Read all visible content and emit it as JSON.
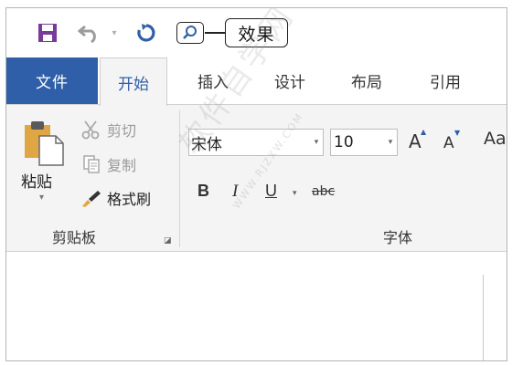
{
  "callout": {
    "text": "效果"
  },
  "tabs": {
    "file": "文件",
    "home": "开始",
    "insert": "插入",
    "design": "设计",
    "layout": "布局",
    "references": "引用"
  },
  "clipboard": {
    "paste": "粘贴",
    "cut": "剪切",
    "copy": "复制",
    "format_painter": "格式刷",
    "group_label": "剪贴板"
  },
  "font": {
    "name": "宋体",
    "size": "10",
    "grow": "A",
    "shrink": "A",
    "change_case": "Aa",
    "bold": "B",
    "italic": "I",
    "underline": "U",
    "strikethrough": "abc",
    "group_label": "字体"
  },
  "watermark": {
    "text": "软件自学网",
    "sub": "WWW.RJZXW.COM"
  },
  "colors": {
    "file_tab": "#2f5fa8",
    "save_icon": "#7a3a9b",
    "redo_icon": "#2f5fa8"
  }
}
